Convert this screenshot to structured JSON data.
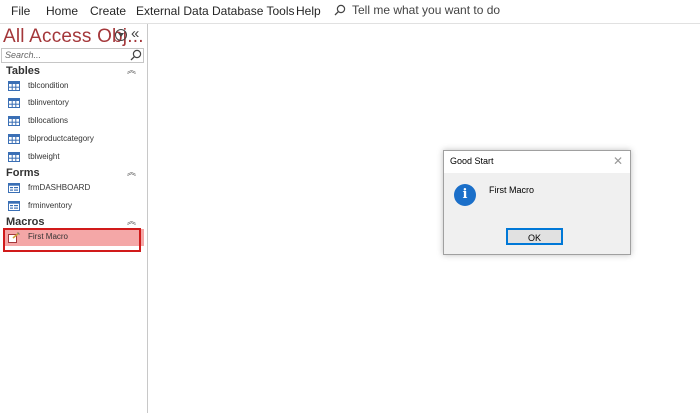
{
  "ribbon": {
    "tabs": [
      "File",
      "Home",
      "Create",
      "External Data",
      "Database Tools",
      "Help"
    ],
    "tell_me": "Tell me what you want to do"
  },
  "nav": {
    "title": "All Access Obj...",
    "search_placeholder": "Search...",
    "groups": [
      {
        "label": "Tables",
        "items": [
          "tblcondition",
          "tblinventory",
          "tbllocations",
          "tblproductcategory",
          "tblweight"
        ]
      },
      {
        "label": "Forms",
        "items": [
          "frmDASHBOARD",
          "frminventory"
        ]
      },
      {
        "label": "Macros",
        "items": [
          "First Macro"
        ]
      }
    ],
    "selected_item": "First Macro",
    "selected_color": "#f4a7a7",
    "highlight_color": "#d11a1a"
  },
  "dialog": {
    "title": "Good Start",
    "message": "First Macro",
    "ok_label": "OK",
    "icon": "info-icon"
  }
}
